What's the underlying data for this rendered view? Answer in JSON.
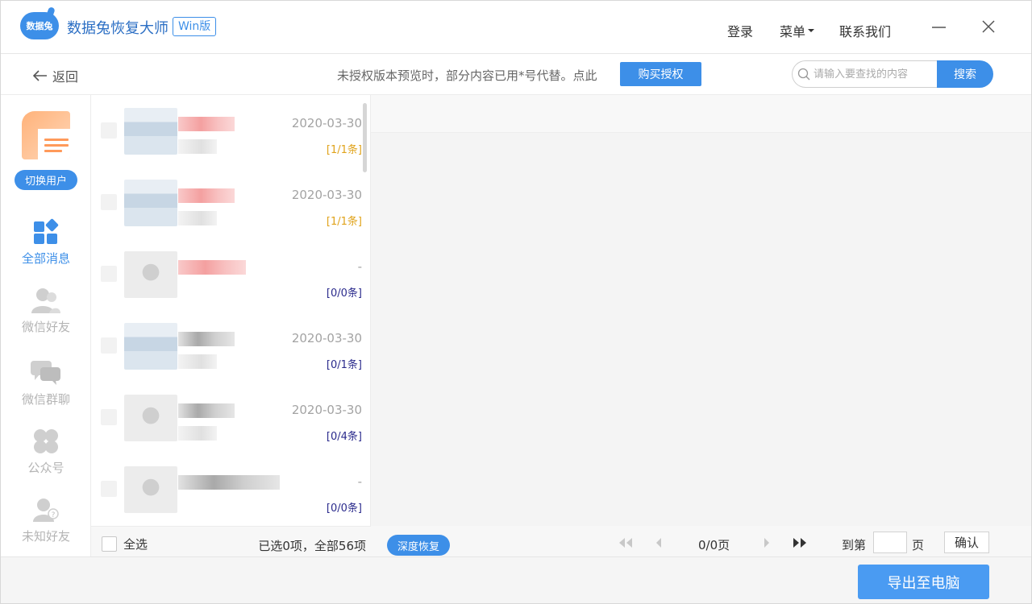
{
  "app": {
    "logo_text": "数据兔",
    "title": "数据兔恢复大师",
    "edition": "Win版"
  },
  "topnav": {
    "login": "登录",
    "menu": "菜单",
    "contact": "联系我们"
  },
  "toolbar": {
    "back": "返回",
    "notice": "未授权版本预览时，部分内容已用*号代替。点此",
    "buy_label": "购买授权",
    "search_placeholder": "请输入要查找的内容",
    "search_label": "搜索"
  },
  "sidebar": {
    "switch_user": "切换用户",
    "items": [
      {
        "label": "全部消息",
        "icon": "all-messages-icon",
        "active": true
      },
      {
        "label": "微信好友",
        "icon": "wechat-friends-icon",
        "active": false
      },
      {
        "label": "微信群聊",
        "icon": "wechat-group-icon",
        "active": false
      },
      {
        "label": "公众号",
        "icon": "official-account-icon",
        "active": false
      },
      {
        "label": "未知好友",
        "icon": "unknown-friend-icon",
        "active": false
      }
    ]
  },
  "list": {
    "rows": [
      {
        "date": "2020-03-30",
        "count": "[1/1条]"
      },
      {
        "date": "2020-03-30",
        "count": "[1/1条]"
      },
      {
        "date": "-",
        "count": "[0/0条]"
      },
      {
        "date": "2020-03-30",
        "count": "[0/1条]"
      },
      {
        "date": "2020-03-30",
        "count": "[0/4条]"
      },
      {
        "date": "-",
        "count": "[0/0条]"
      }
    ],
    "select_all": "全选",
    "selection_status": "已选0项，全部56项"
  },
  "content": {
    "deep_recover": "深度恢复",
    "page_info": "0/0页",
    "goto_label": "到第",
    "page_unit": "页",
    "confirm": "确认"
  },
  "footer": {
    "export": "导出至电脑"
  },
  "colors": {
    "accent": "#3d8fe8",
    "count_highlight": "#e0a31b",
    "count_normal": "#2a2a8c"
  }
}
